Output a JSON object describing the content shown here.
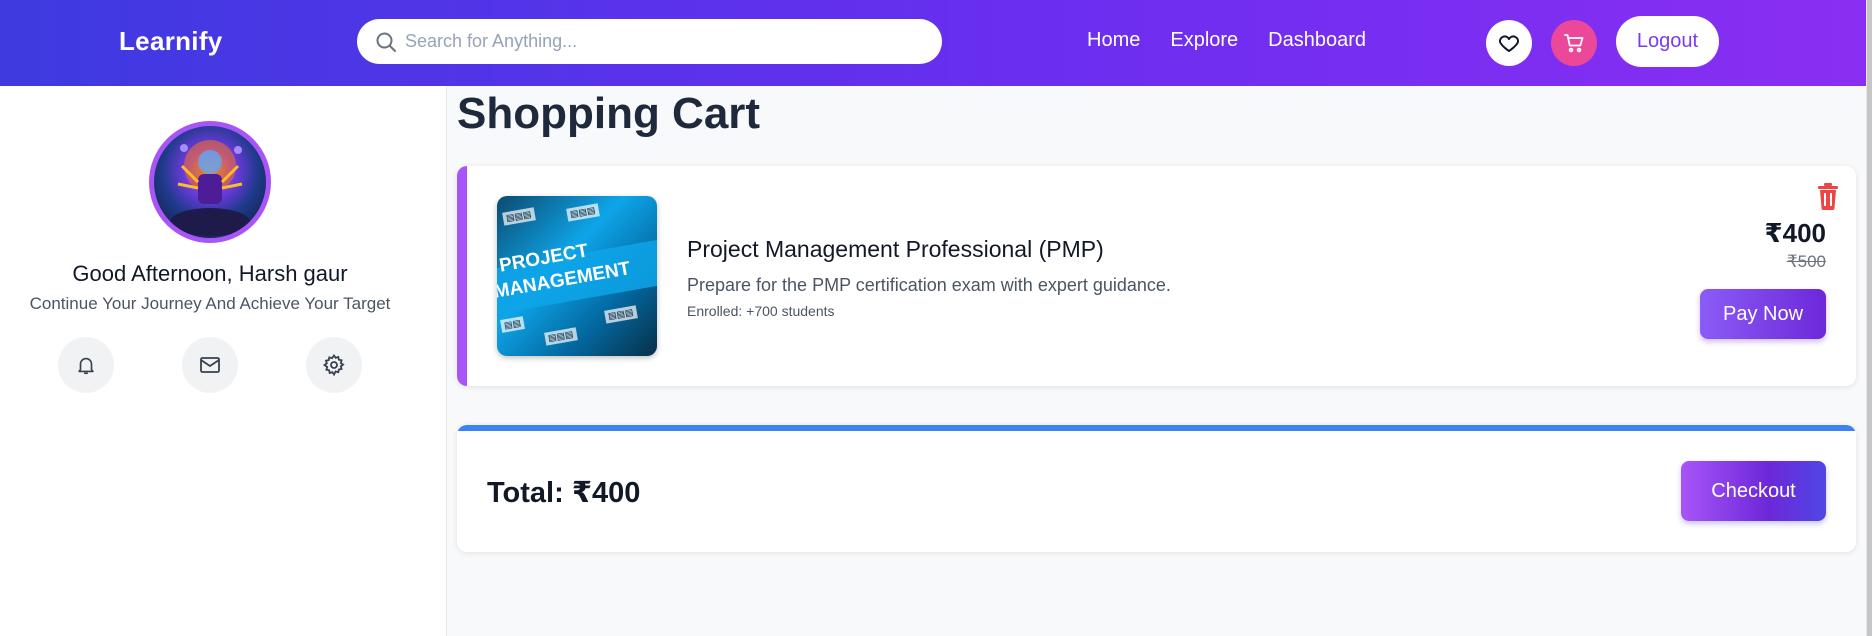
{
  "navbar": {
    "logo": "Learnify",
    "search_placeholder": "Search for Anything...",
    "links": [
      "Home",
      "Explore",
      "Dashboard"
    ],
    "logout_label": "Logout",
    "icons": [
      "heart-icon",
      "cart-icon"
    ]
  },
  "sidebar": {
    "greeting": "Good Afternoon, Harsh gaur",
    "subtitle": "Continue Your Journey And Achieve Your Target",
    "icons": [
      "bell-icon",
      "mail-icon",
      "settings-icon"
    ]
  },
  "main": {
    "title": "Shopping Cart",
    "cart_item": {
      "title": "Project Management Professional (PMP)",
      "description": "Prepare for the PMP certification exam with expert guidance.",
      "enrolled": "Enrolled: +700 students",
      "price": "₹400",
      "old_price": "₹500",
      "pay_label": "Pay Now",
      "thumb_line1": "PROJECT",
      "thumb_line2": "MANAGEMENT"
    },
    "total": {
      "label": "Total: ₹400",
      "checkout_label": "Checkout"
    }
  },
  "colors": {
    "nav_gradient_start": "#3d3ae0",
    "nav_gradient_end": "#8a2ef2",
    "accent_purple": "#a855f7",
    "cart_pink": "#ec4899",
    "total_bar_blue": "#3b82f6",
    "trash_red": "#ef4444"
  }
}
